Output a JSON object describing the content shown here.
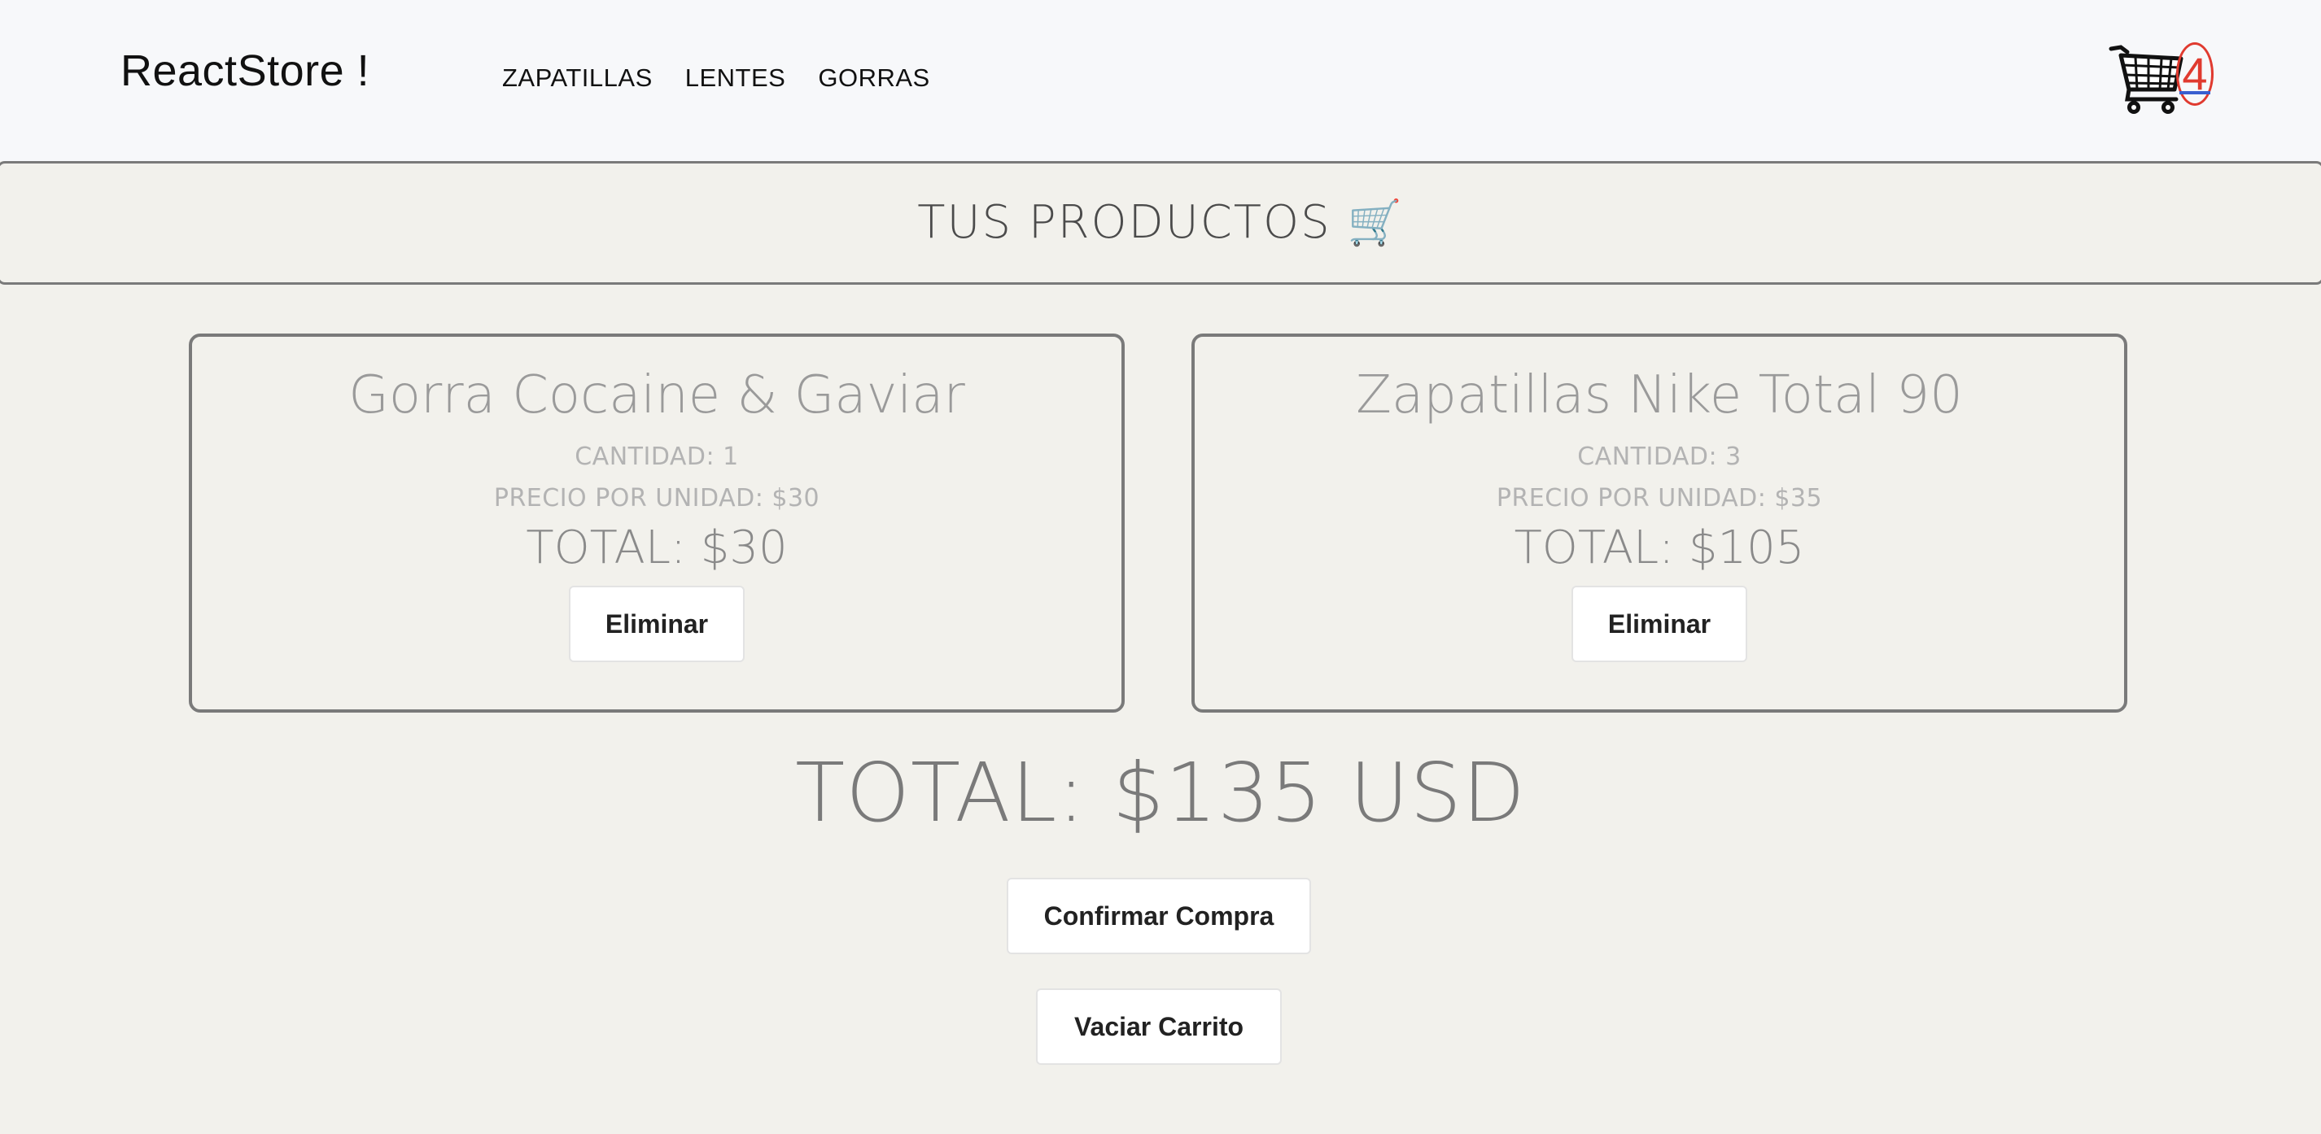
{
  "navbar": {
    "brand": "ReactStore !",
    "links": [
      "ZAPATILLAS",
      "LENTES",
      "GORRAS"
    ],
    "cart_count": "4",
    "cart_icon": "shopping-cart-icon"
  },
  "section": {
    "title": "TUS PRODUCTOS",
    "title_emoji": "🛒"
  },
  "products": [
    {
      "name": "Gorra Cocaine & Gaviar",
      "quantity": "CANTIDAD: 1",
      "unit_price": "PRECIO POR UNIDAD: $30",
      "total": "TOTAL: $30",
      "remove_label": "Eliminar"
    },
    {
      "name": "Zapatillas Nike Total 90",
      "quantity": "CANTIDAD: 3",
      "unit_price": "PRECIO POR UNIDAD: $35",
      "total": "TOTAL: $105",
      "remove_label": "Eliminar"
    }
  ],
  "summary": {
    "grand_total": "TOTAL: $135 USD",
    "confirm_label": "Confirmar Compra",
    "empty_label": "Vaciar Carrito"
  },
  "colors": {
    "page_background": "#f2f1ec",
    "navbar_background": "#f7f8fa",
    "badge_red": "#e03a2f",
    "badge_blue": "#3a5fd0"
  }
}
